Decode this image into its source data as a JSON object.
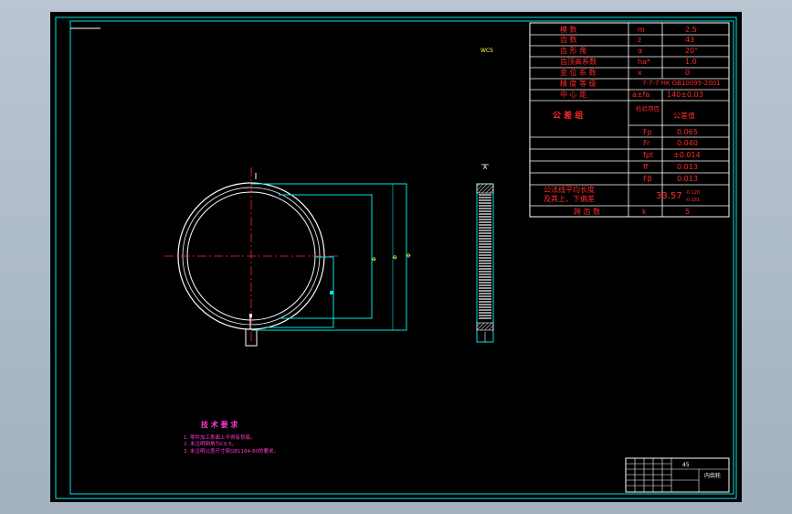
{
  "drawing": {
    "view_cube_label": "WCS",
    "section_mark": "A",
    "dim_labels": [
      "Φ",
      "Φ",
      "Φ"
    ],
    "tech_requirements": {
      "title": "技 术 要 求",
      "items": [
        "1. 零件加工表面上不得有划痕。",
        "2. 未注明倒角为C0.5。",
        "3. 未注明公差尺寸按GB1184-80的要求。"
      ]
    }
  },
  "params_table": {
    "rows": [
      {
        "name": "模    数",
        "symbol": "m",
        "value": "2.5"
      },
      {
        "name": "齿    数",
        "symbol": "z",
        "value": "43"
      },
      {
        "name": "齿 形 角",
        "symbol": "α",
        "value": "20°"
      },
      {
        "name": "齿顶高系数",
        "symbol": "ha*",
        "value": "1.0"
      },
      {
        "name": "变 位 系 数",
        "symbol": "x",
        "value": "0"
      },
      {
        "name": "精 度 等 级",
        "symbol": "",
        "value": "7-7-7 HK GB10095-2001"
      },
      {
        "name": "中  心  距",
        "symbol": "a±fa",
        "value": "140±0.03"
      }
    ],
    "tolerance_group": {
      "label": "公  差  组",
      "check_item_label": "检验项目",
      "group_value": "公差值",
      "items": [
        {
          "symbol": "Fp",
          "value": "0.065"
        },
        {
          "symbol": "Fr",
          "value": "0.040"
        },
        {
          "symbol": "fpt",
          "value": "±0.014"
        },
        {
          "symbol": "ff",
          "value": "0.013"
        },
        {
          "symbol": "Fβ",
          "value": "0.013"
        }
      ]
    },
    "common_normal": {
      "label_line1": "公法线平均长度",
      "label_line2": "及其上、下偏差",
      "value": "33.57",
      "upper": "-0.120",
      "lower": "-0.181"
    },
    "span_row": {
      "name": "跨  齿  数",
      "symbol": "k",
      "value": "5"
    }
  },
  "title_block": {
    "material": "45",
    "part_name": "内齿轮"
  },
  "colors": {
    "frame": "#00e5e5",
    "centerline": "#ff2a2a",
    "part": "#ffffff",
    "text_red": "#ff2a2a",
    "background": "#000000"
  }
}
